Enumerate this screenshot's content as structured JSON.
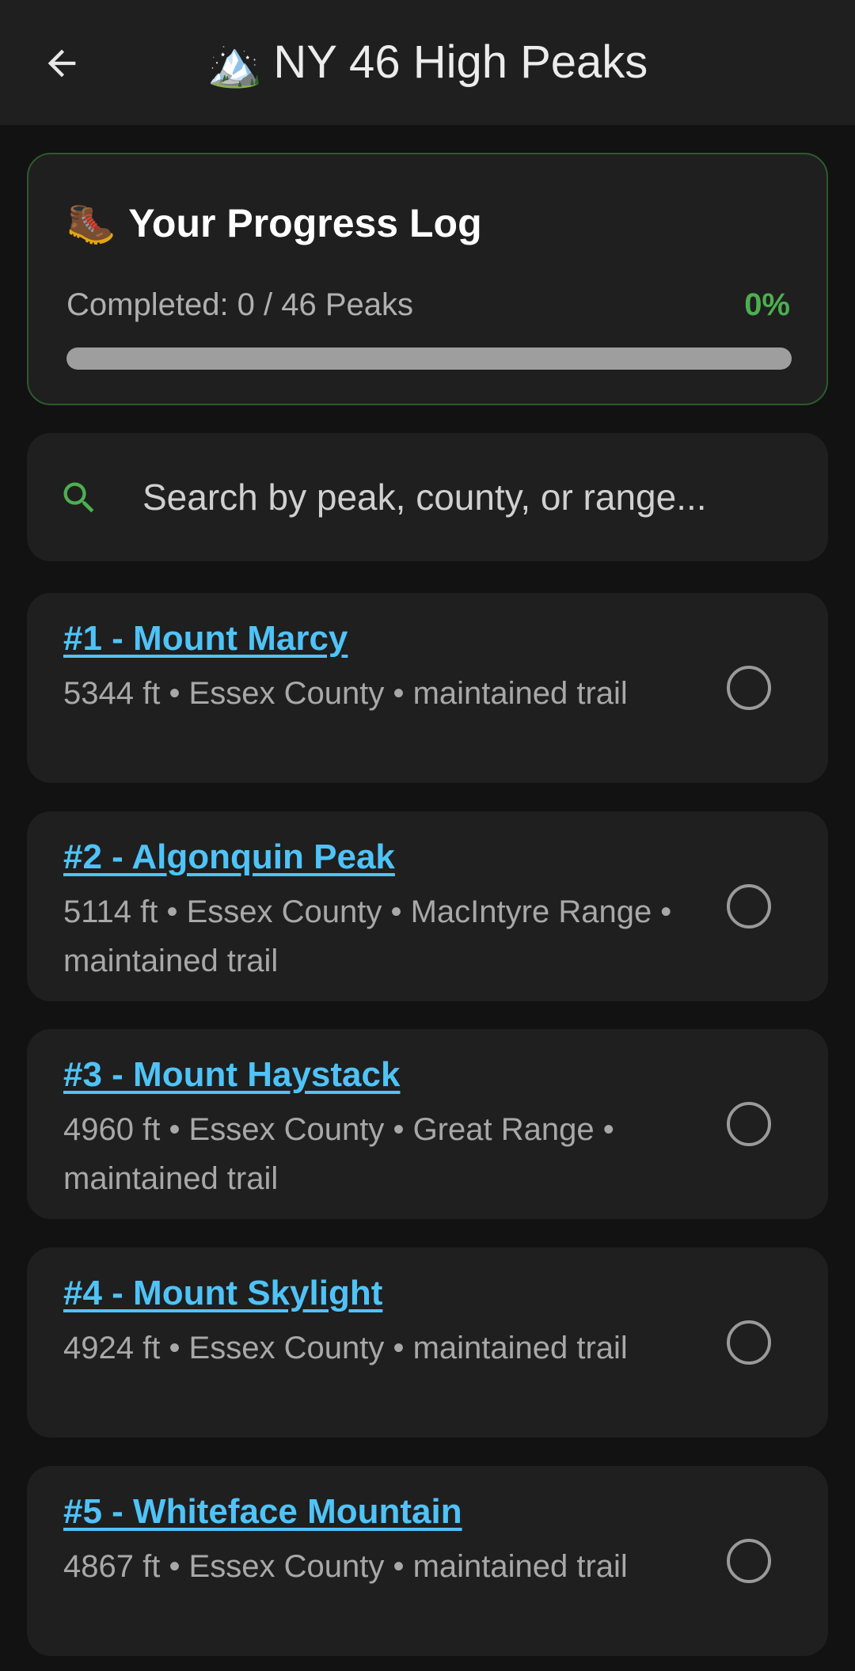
{
  "app_bar": {
    "title_emoji": "🏔️",
    "title": "NY 46 High Peaks",
    "back_icon": "arrow-left-icon"
  },
  "progress": {
    "heading_emoji": "🥾",
    "heading": "Your Progress Log",
    "completed_text": "Completed: 0 / 46 Peaks",
    "percent_text": "0%",
    "fraction": 0,
    "colors": {
      "accent": "#4caf50",
      "track": "#9e9e9e",
      "border": "#2c5a2e"
    }
  },
  "search": {
    "placeholder": "Search by peak, county, or range...",
    "value": "",
    "icon": "search-icon",
    "icon_color": "#4caf50"
  },
  "peaks": [
    {
      "name": "#1 - Mount Marcy",
      "details": "5344 ft • Essex County • maintained trail",
      "checked": false
    },
    {
      "name": "#2 - Algonquin Peak",
      "details": "5114 ft • Essex County • MacIntyre Range • maintained trail",
      "checked": false
    },
    {
      "name": "#3 - Mount Haystack",
      "details": "4960 ft • Essex County • Great Range • maintained trail",
      "checked": false
    },
    {
      "name": "#4 - Mount Skylight",
      "details": "4924 ft • Essex County • maintained trail",
      "checked": false
    },
    {
      "name": "#5 - Whiteface Mountain",
      "details": "4867 ft • Essex County • maintained trail",
      "checked": false
    }
  ],
  "colors": {
    "background": "#121212",
    "surface": "#1f1f1f",
    "link": "#4fc3f7"
  }
}
